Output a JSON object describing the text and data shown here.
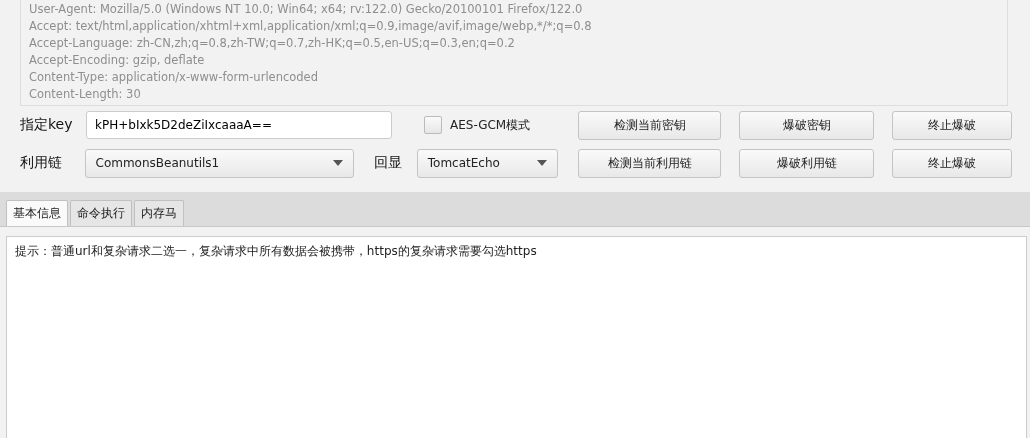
{
  "request_headers": {
    "disabled": true,
    "lines": [
      "User-Agent: Mozilla/5.0 (Windows NT 10.0; Win64; x64; rv:122.0) Gecko/20100101 Firefox/122.0",
      "Accept: text/html,application/xhtml+xml,application/xml;q=0.9,image/avif,image/webp,*/*;q=0.8",
      "Accept-Language: zh-CN,zh;q=0.8,zh-TW;q=0.7,zh-HK;q=0.5,en-US;q=0.3,en;q=0.2",
      "Accept-Encoding: gzip, deflate",
      "Content-Type: application/x-www-form-urlencoded",
      "Content-Length: 30"
    ]
  },
  "key": {
    "label": "指定key",
    "value": "kPH+bIxk5D2deZiIxcaaaA=="
  },
  "aes_gcm": {
    "label": "AES-GCM模式",
    "checked": false
  },
  "key_buttons": [
    "检测当前密钥",
    "爆破密钥",
    "终止爆破"
  ],
  "gadget": {
    "label": "利用链",
    "value": "CommonsBeanutils1"
  },
  "echo": {
    "label": "回显",
    "value": "TomcatEcho"
  },
  "gadget_buttons": [
    "检测当前利用链",
    "爆破利用链",
    "终止爆破"
  ],
  "tabs": [
    {
      "label": "基本信息",
      "selected": true
    },
    {
      "label": "命令执行",
      "selected": false
    },
    {
      "label": "内存马",
      "selected": false
    }
  ],
  "output": {
    "text": "提示：普通url和复杂请求二选一，复杂请求中所有数据会被携带，https的复杂请求需要勾选https"
  }
}
